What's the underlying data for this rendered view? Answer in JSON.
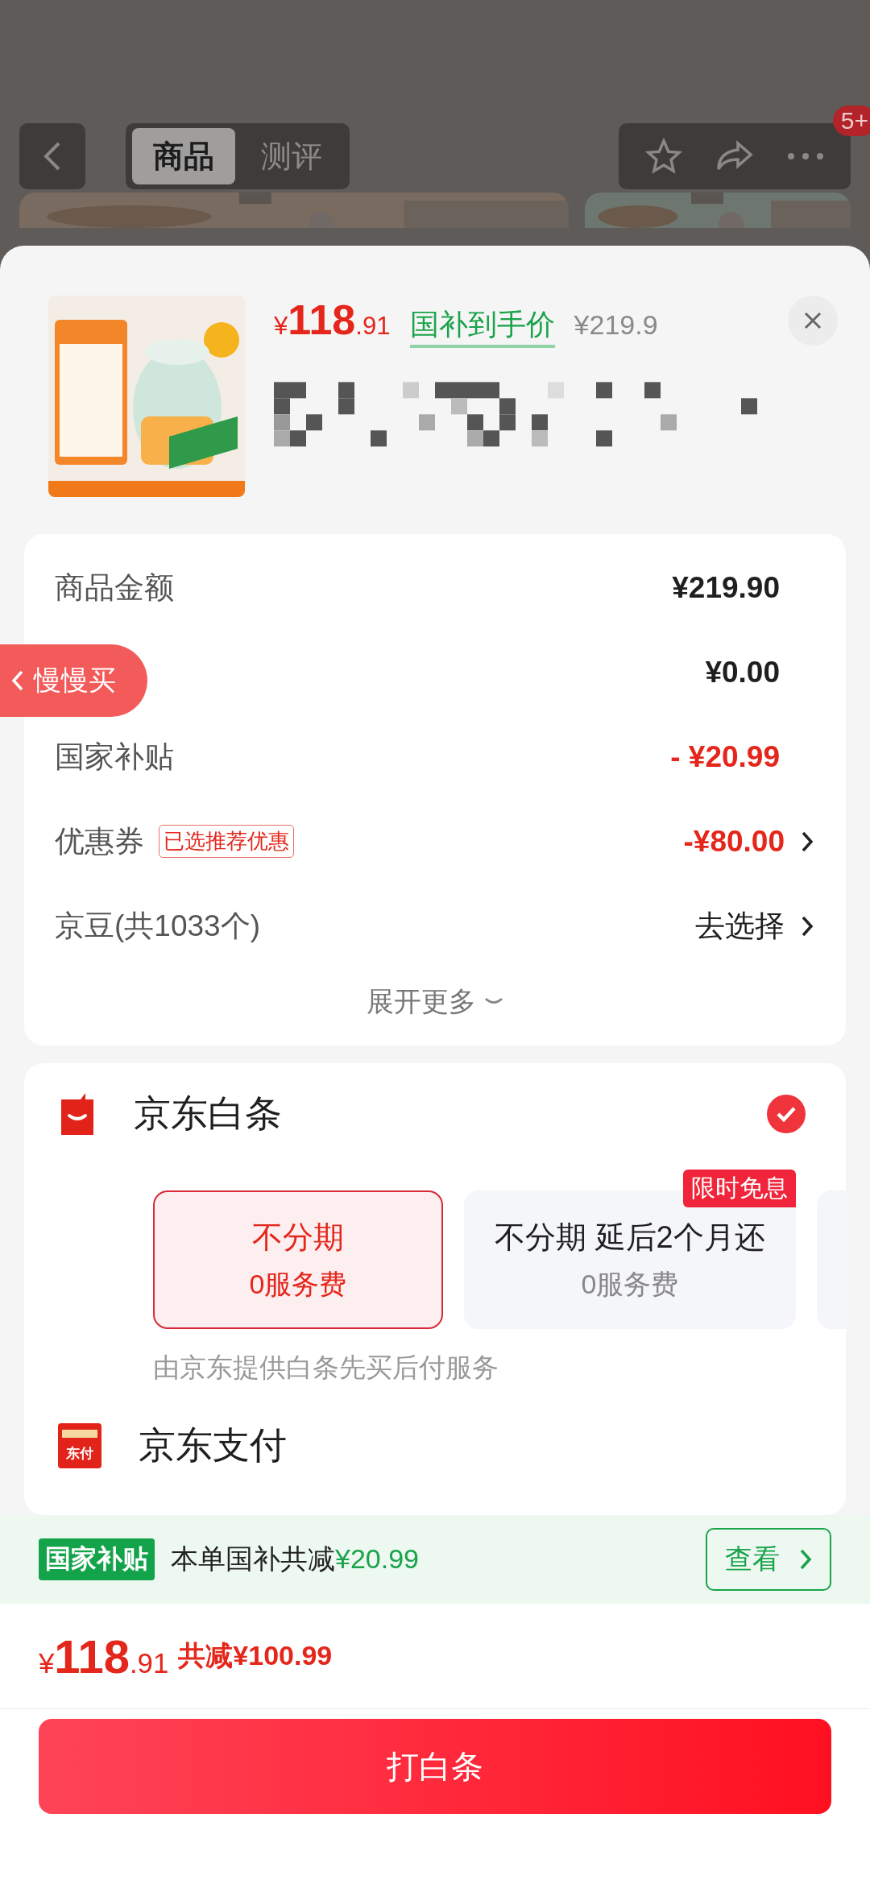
{
  "nav": {
    "tabs": [
      {
        "label": "商品",
        "selected": true
      },
      {
        "label": "测评",
        "selected": false
      }
    ],
    "badge": "5+"
  },
  "product": {
    "price": {
      "currency": "¥",
      "integer": "118",
      "decimal": ".91"
    },
    "price_label": "国补到手价",
    "original_price": "¥219.9"
  },
  "summary_rows": [
    {
      "label": "商品金额",
      "value": "¥219.90",
      "kind": "amount",
      "chevron": false
    },
    {
      "value": "¥0.00",
      "kind": "amount",
      "chevron": false
    },
    {
      "label": "国家补贴",
      "value": "- ¥20.99",
      "kind": "discount",
      "chevron": false
    },
    {
      "label": "优惠券",
      "tag": "已选推荐优惠",
      "value": "-¥80.00",
      "kind": "discount",
      "chevron": true
    },
    {
      "label": "京豆(共1033个)",
      "value": "去选择",
      "kind": "action",
      "chevron": true
    }
  ],
  "expand": "展开更多",
  "floating_tab": "慢慢买",
  "payment_methods": [
    {
      "kind": "baitiao",
      "name": "京东白条",
      "checked": true,
      "options": [
        {
          "title": "不分期",
          "fee": "0服务费",
          "selected": true
        },
        {
          "title": "不分期 延后2个月还",
          "fee": "0服务费",
          "badge": "限时免息",
          "selected": false
        }
      ],
      "note": "由京东提供白条先买后付服务"
    },
    {
      "kind": "jdpay",
      "name": "京东支付",
      "icon_text": "东付"
    }
  ],
  "subsidy_bar": {
    "badge": "国家补贴",
    "text": "本单国补共减",
    "amount": "¥20.99",
    "button": "查看"
  },
  "total": {
    "currency": "¥",
    "integer": "118",
    "decimal": ".91",
    "saving": "共减¥100.99"
  },
  "submit": "打白条"
}
